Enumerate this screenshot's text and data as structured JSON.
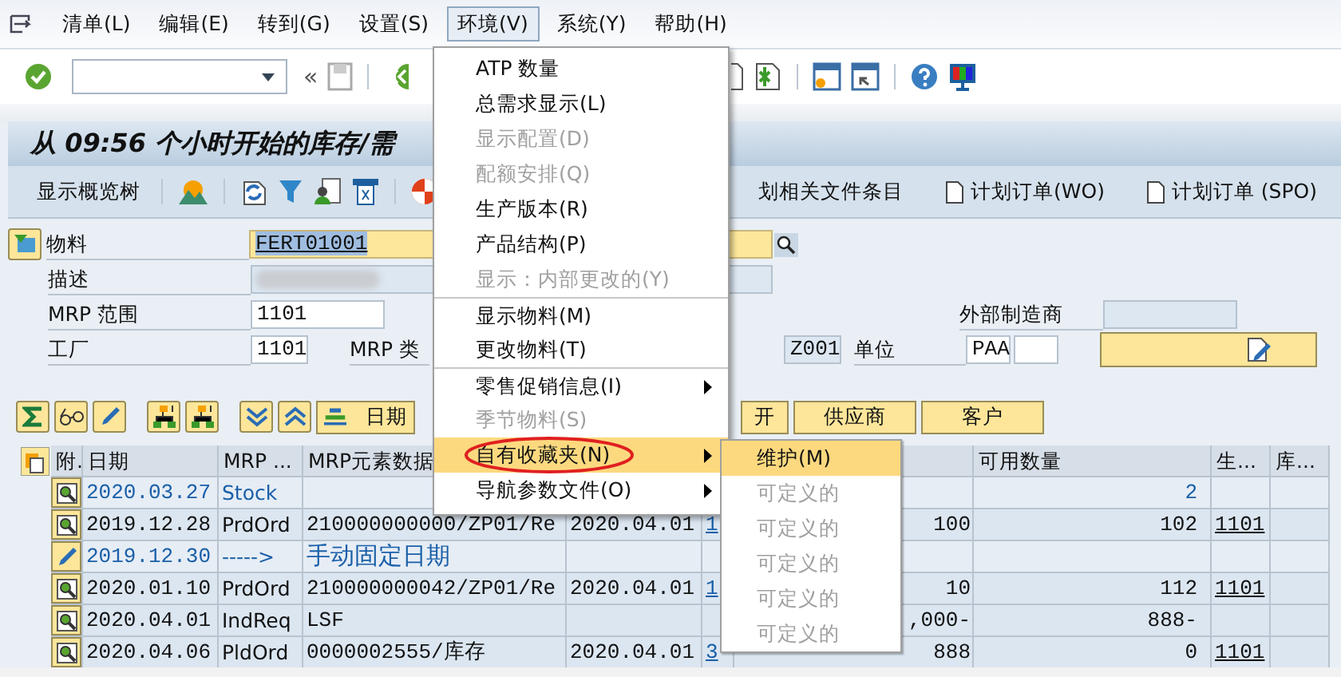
{
  "menu_bar": [
    {
      "label": "清单(L)",
      "selected": false
    },
    {
      "label": "编辑(E)",
      "selected": false
    },
    {
      "label": "转到(G)",
      "selected": false
    },
    {
      "label": "设置(S)",
      "selected": false
    },
    {
      "label": "环境(V)",
      "selected": true
    },
    {
      "label": "系统(Y)",
      "selected": false
    },
    {
      "label": "帮助(H)",
      "selected": false
    }
  ],
  "toolbar": {
    "history_arrow": "«"
  },
  "title": "从 09:56 个小时开始的库存/需",
  "app_toolbar": {
    "overview_button": "显示概览树",
    "right_buttons": [
      "划相关文件条目",
      "计划订单(WO)",
      "计划订单 (SPO)"
    ]
  },
  "form": {
    "material_label": "物料",
    "material": "FERT01001",
    "description_label": "描述",
    "mrp_area_label": "MRP 范围",
    "mrp_area": "1101",
    "external_manufacturer_label": "外部制造商",
    "plant_label": "工厂",
    "plant": "1101",
    "mrp_type_label": "MRP 类",
    "mrp_type": "Z001",
    "unit_label": "单位",
    "unit": "PAA"
  },
  "button_row": {
    "date_button": "日期",
    "partial_button": "开",
    "vendor_button": "供应商",
    "customer_button": "客户"
  },
  "table": {
    "columns": {
      "attachment": "附.",
      "date": "日期",
      "mrp_element": "MRP ...",
      "element_data": "MRP元素数据",
      "available": "可用数量",
      "column_9": "生...",
      "column_10": "库..."
    },
    "rows": [
      {
        "kind": "stock",
        "date": "2020.03.27",
        "mrp_element": "Stock",
        "available": "2"
      },
      {
        "kind": "element",
        "date": "2019.12.28",
        "mrp_element": "PrdOrd",
        "element_data": "210000000000/ZP01/Re",
        "column_5": "2020.04.01",
        "column_6": "1",
        "column_7": "100",
        "available": "102",
        "column_9": "1101"
      },
      {
        "kind": "firming",
        "date": "2019.12.30",
        "mrp_element": "----->",
        "element_data": "手动固定日期"
      },
      {
        "kind": "element",
        "date": "2020.01.10",
        "mrp_element": "PrdOrd",
        "element_data": "210000000042/ZP01/Re",
        "column_5": "2020.04.01",
        "column_6": "1",
        "column_7": "10",
        "available": "112",
        "column_9": "1101"
      },
      {
        "kind": "element",
        "date": "2020.04.01",
        "mrp_element": "IndReq",
        "element_data": "LSF",
        "column_7": ",000-",
        "available": "888-"
      },
      {
        "kind": "element",
        "date": "2020.04.06",
        "mrp_element": "PldOrd",
        "element_data": "0000002555/库存",
        "column_5": "2020.04.01",
        "column_6": "3",
        "column_7": "888",
        "available": "0",
        "column_9": "1101"
      }
    ]
  },
  "menu": {
    "items": [
      {
        "label": "ATP 数量",
        "disabled": false,
        "submenu": false,
        "selected": false,
        "separator_before": false,
        "circled": false
      },
      {
        "label": "总需求显示(L)",
        "disabled": false,
        "submenu": false,
        "selected": false,
        "separator_before": false,
        "circled": false
      },
      {
        "label": "显示配置(D)",
        "disabled": true,
        "submenu": false,
        "selected": false,
        "separator_before": false,
        "circled": false
      },
      {
        "label": "配额安排(Q)",
        "disabled": true,
        "submenu": false,
        "selected": false,
        "separator_before": false,
        "circled": false
      },
      {
        "label": "生产版本(R)",
        "disabled": false,
        "submenu": false,
        "selected": false,
        "separator_before": false,
        "circled": false
      },
      {
        "label": "产品结构(P)",
        "disabled": false,
        "submenu": false,
        "selected": false,
        "separator_before": false,
        "circled": false
      },
      {
        "label": "显示：内部更改的(Y)",
        "disabled": true,
        "submenu": false,
        "selected": false,
        "separator_before": false,
        "circled": false
      },
      {
        "label": "显示物料(M)",
        "disabled": false,
        "submenu": false,
        "selected": false,
        "separator_before": true,
        "circled": false
      },
      {
        "label": "更改物料(T)",
        "disabled": false,
        "submenu": false,
        "selected": false,
        "separator_before": false,
        "circled": false
      },
      {
        "label": "零售促销信息(I)",
        "disabled": false,
        "submenu": true,
        "selected": false,
        "separator_before": true,
        "circled": false
      },
      {
        "label": "季节物料(S)",
        "disabled": true,
        "submenu": false,
        "selected": false,
        "separator_before": false,
        "circled": false
      },
      {
        "label": "自有收藏夹(N)",
        "disabled": false,
        "submenu": true,
        "selected": true,
        "separator_before": false,
        "circled": true
      },
      {
        "label": "导航参数文件(O)",
        "disabled": false,
        "submenu": true,
        "selected": false,
        "separator_before": false,
        "circled": false
      }
    ]
  },
  "submenu": {
    "items": [
      {
        "label": "维护(M)",
        "disabled": false,
        "selected": true
      },
      {
        "label": "可定义的",
        "disabled": true,
        "selected": false
      },
      {
        "label": "可定义的",
        "disabled": true,
        "selected": false
      },
      {
        "label": "可定义的",
        "disabled": true,
        "selected": false
      },
      {
        "label": "可定义的",
        "disabled": true,
        "selected": false
      },
      {
        "label": "可定义的",
        "disabled": true,
        "selected": false
      }
    ]
  }
}
